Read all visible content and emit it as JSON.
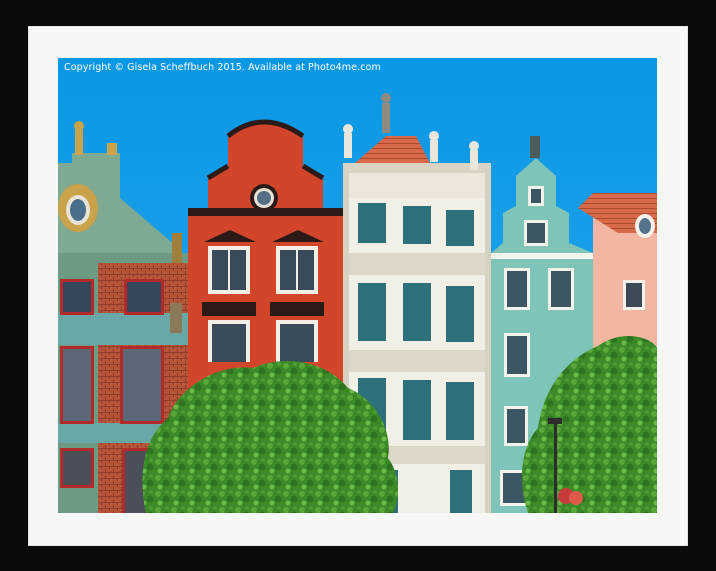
{
  "watermark": {
    "copyright_text": "Copyright © Gisela Scheffbuch 2015. Available at Photo4me.com"
  },
  "colors": {
    "frame": "#0b0b0b",
    "mount": "#f7f7f5",
    "sky": "#0a9be6",
    "red_house": "#d2452b",
    "white_house": "#f2efe6",
    "green_house": "#7fc4b8",
    "tree": "#3f8f2a"
  }
}
